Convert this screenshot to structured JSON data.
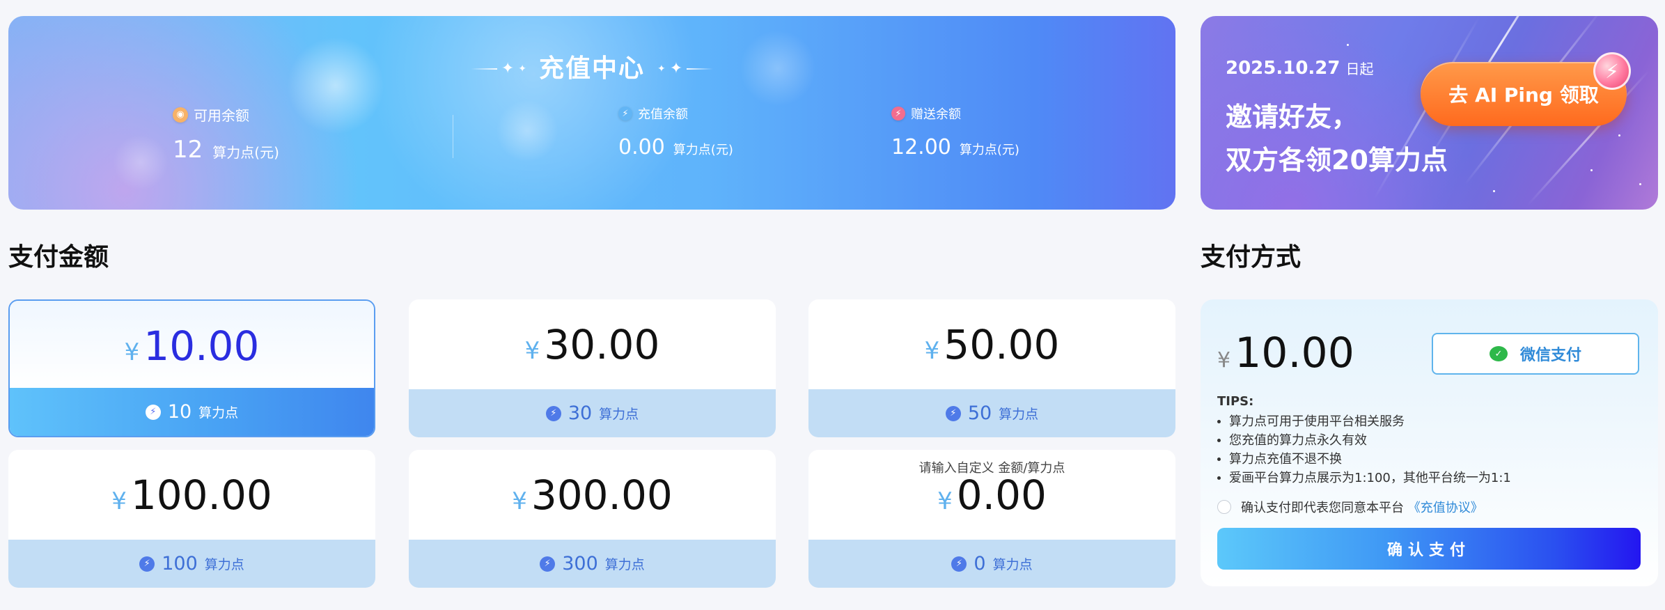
{
  "banner": {
    "title": "充值中心",
    "stats": [
      {
        "label": "可用余额",
        "value": "12",
        "unit": "算力点(元)",
        "icon": "coin-icon",
        "icon_color": "#f7b267"
      },
      {
        "label": "充值余额",
        "value": "0.00",
        "unit": "算力点(元)",
        "icon": "bolt-icon",
        "icon_color": "#62b5f5"
      },
      {
        "label": "赠送余额",
        "value": "12.00",
        "unit": "算力点(元)",
        "icon": "gift-bolt-icon",
        "icon_color": "#f26d8e"
      }
    ]
  },
  "promo": {
    "date": "2025.10.27",
    "date_suffix": "日起",
    "line1": "邀请好友，",
    "line2": "双方各领20算力点",
    "cta_label": "去 AI Ping 领取"
  },
  "amount_section": {
    "title": "支付金额",
    "currency": "¥",
    "points_unit": "算力点",
    "options": [
      {
        "amount": "10.00",
        "points": "10",
        "selected": true
      },
      {
        "amount": "30.00",
        "points": "30",
        "selected": false
      },
      {
        "amount": "50.00",
        "points": "50",
        "selected": false
      },
      {
        "amount": "100.00",
        "points": "100",
        "selected": false
      },
      {
        "amount": "300.00",
        "points": "300",
        "selected": false
      }
    ],
    "custom": {
      "hint": "请输入自定义 金额/算力点",
      "amount": "0.00",
      "points": "0"
    }
  },
  "payment": {
    "title": "支付方式",
    "currency": "¥",
    "amount": "10.00",
    "method_label": "微信支付",
    "tips_title": "TIPS:",
    "tips": [
      "算力点可用于使用平台相关服务",
      "您充值的算力点永久有效",
      "算力点充值不退不换",
      "爱画平台算力点展示为1:100，其他平台统一为1:1"
    ],
    "agree_text": "确认支付即代表您同意本平台",
    "agree_link": "《充值协议》",
    "confirm_label": "确认支付"
  },
  "colors": {
    "accent": "#2a2de0",
    "link": "#2f8ad8",
    "wechat": "#2eb84a",
    "card_bottom": "#c2ddf5"
  }
}
